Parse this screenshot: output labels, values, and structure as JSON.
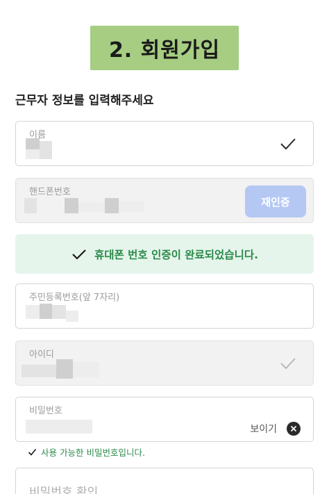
{
  "banner": {
    "text": "2. 회원가입"
  },
  "heading": "근무자 정보를 입력해주세요",
  "fields": {
    "name": {
      "label": "이름"
    },
    "phone": {
      "label": "핸드폰번호",
      "button": "재인증"
    },
    "rrn": {
      "label": "주민등록번호(앞 7자리)"
    },
    "userid": {
      "label": "아이디"
    },
    "password": {
      "label": "비밀번호",
      "show": "보이기"
    },
    "password_confirm": {
      "placeholder": "비밀번호 확인"
    }
  },
  "notice": {
    "text": "휴대폰 번호 인증이 완료되었습니다."
  },
  "password_hint": "사용 가능한 비밀번호입니다.",
  "colors": {
    "banner": "#a6cd82",
    "success": "#2a8a4a",
    "notice_bg": "#e6f5ec",
    "button": "#b5c8f4"
  }
}
